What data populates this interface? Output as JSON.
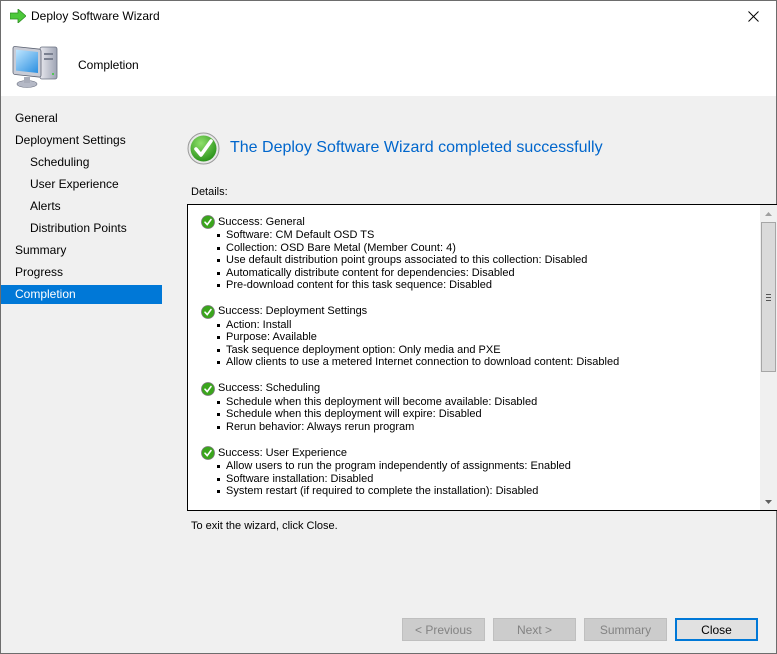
{
  "window": {
    "title": "Deploy Software Wizard",
    "icon": "green-arrow-icon",
    "close_icon": "close-icon"
  },
  "header": {
    "title": "Completion",
    "icon": "computer-icon"
  },
  "sidebar": {
    "items": [
      {
        "label": "General",
        "level": 0,
        "active": false
      },
      {
        "label": "Deployment Settings",
        "level": 0,
        "active": false
      },
      {
        "label": "Scheduling",
        "level": 1,
        "active": false
      },
      {
        "label": "User Experience",
        "level": 1,
        "active": false
      },
      {
        "label": "Alerts",
        "level": 1,
        "active": false
      },
      {
        "label": "Distribution Points",
        "level": 1,
        "active": false
      },
      {
        "label": "Summary",
        "level": 0,
        "active": false
      },
      {
        "label": "Progress",
        "level": 0,
        "active": false
      },
      {
        "label": "Completion",
        "level": 0,
        "active": true
      }
    ]
  },
  "main": {
    "success_title": "The Deploy Software Wizard completed successfully",
    "details_label": "Details:",
    "exit_text": "To exit the wizard, click Close.",
    "sections": [
      {
        "title": "Success: General",
        "items": [
          "Software: CM Default OSD TS",
          "Collection: OSD Bare Metal (Member Count: 4)",
          "Use default distribution point groups associated to this collection: Disabled",
          "Automatically distribute content for dependencies: Disabled",
          "Pre-download content for this task sequence: Disabled"
        ]
      },
      {
        "title": "Success: Deployment Settings",
        "items": [
          "Action: Install",
          "Purpose: Available",
          "Task sequence deployment option: Only media and PXE",
          "Allow clients to use a metered Internet connection to download content: Disabled"
        ]
      },
      {
        "title": "Success: Scheduling",
        "items": [
          "Schedule when this deployment will become available: Disabled",
          "Schedule when this deployment will expire: Disabled",
          "Rerun behavior: Always rerun program"
        ]
      },
      {
        "title": "Success: User Experience",
        "items": [
          "Allow users to run the program independently of assignments: Enabled",
          "Software installation: Disabled",
          "System restart (if required to complete the installation): Disabled"
        ]
      }
    ]
  },
  "footer": {
    "previous_label": "< Previous",
    "next_label": "Next >",
    "summary_label": "Summary",
    "close_label": "Close"
  },
  "colors": {
    "accent": "#0078d7",
    "title_blue": "#0066cc",
    "success_green": "#3aa51c"
  }
}
